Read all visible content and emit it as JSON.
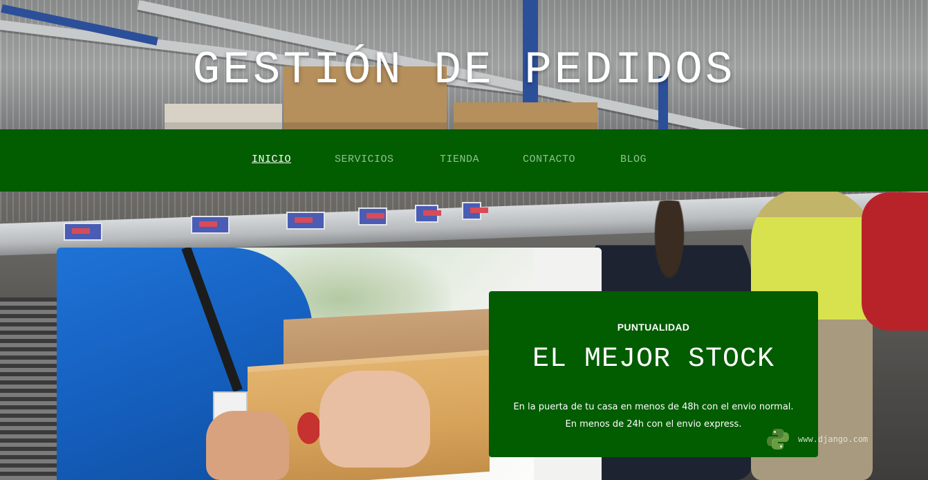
{
  "header": {
    "title": "GESTIÓN DE PEDIDOS"
  },
  "nav": {
    "items": [
      {
        "label": "INICIO",
        "active": true
      },
      {
        "label": "SERVICIOS",
        "active": false
      },
      {
        "label": "TIENDA",
        "active": false
      },
      {
        "label": "CONTACTO",
        "active": false
      },
      {
        "label": "BLOG",
        "active": false
      }
    ]
  },
  "feature": {
    "kicker": "PUNTUALIDAD",
    "heading": "EL MEJOR STOCK",
    "lines": [
      "En la puerta de tu casa en menos de 48h con el envio normal.",
      "En menos de 24h con el envio express."
    ]
  },
  "watermark": {
    "icon": "python-logo-icon",
    "url": "www.django.com"
  },
  "colors": {
    "brand_green": "#025c00",
    "nav_inactive": "#8fc38d",
    "nav_active": "#ffffff"
  }
}
